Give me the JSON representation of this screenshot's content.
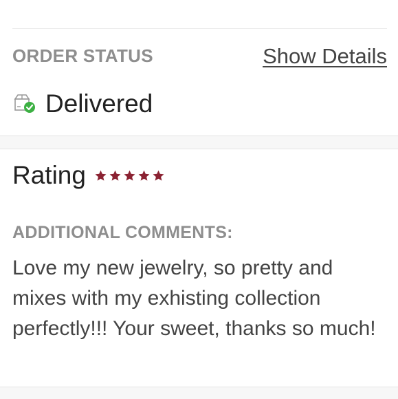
{
  "order": {
    "status_label": "ORDER STATUS",
    "show_details_label": "Show Details",
    "status_icon": "package-delivered-icon",
    "status_value": "Delivered"
  },
  "rating": {
    "label": "Rating",
    "stars": 5,
    "max_stars": 5,
    "star_color": "#8b2232"
  },
  "comments": {
    "label": "ADDITIONAL COMMENTS:",
    "text": "Love my new jewelry, so pretty and mixes with my exhisting collection perfectly!!! Your sweet, thanks so much!"
  },
  "colors": {
    "label_gray": "#8e8e8e",
    "text_dark": "#222222",
    "text_body": "#444444",
    "check_green": "#3cb043"
  }
}
